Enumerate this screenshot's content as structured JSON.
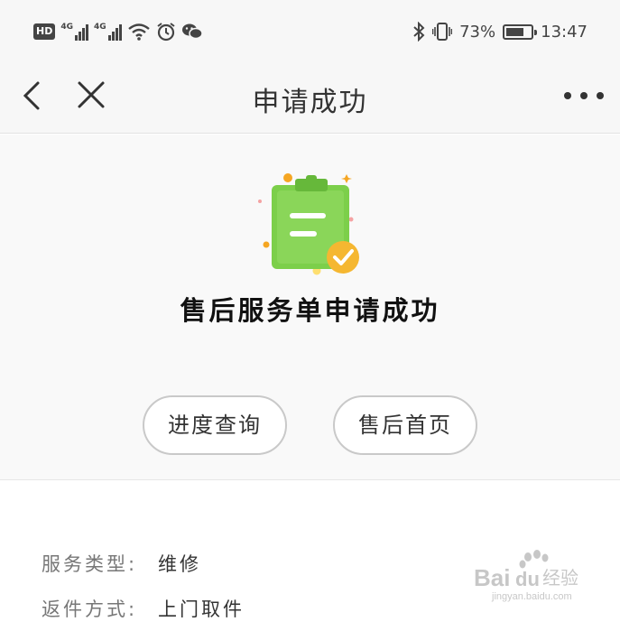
{
  "status_bar": {
    "hd_badge": "HD",
    "network_1": "4G",
    "network_2": "4G",
    "icons": [
      "wifi-icon",
      "alarm-icon",
      "wechat-icon",
      "bluetooth-icon",
      "vibrate-icon"
    ],
    "battery_percent": "73%",
    "battery_level": 0.73,
    "time": "13:47"
  },
  "nav": {
    "title": "申请成功",
    "icons": [
      "back-chevron-icon",
      "close-icon",
      "more-icon"
    ]
  },
  "success": {
    "message": "售后服务单申请成功",
    "illustration": "clipboard-check-icon",
    "colors": {
      "clipboard": "#7ccf4a",
      "check_badge": "#f5b731"
    },
    "buttons": {
      "progress_label": "进度查询",
      "home_label": "售后首页"
    }
  },
  "details": {
    "rows": [
      {
        "label": "服务类型:",
        "value": "维修"
      },
      {
        "label": "返件方式:",
        "value": "上门取件"
      }
    ]
  },
  "watermark": {
    "brand": "Bai",
    "brand_suffix": "du",
    "product": "经验",
    "url": "jingyan.baidu.com"
  }
}
